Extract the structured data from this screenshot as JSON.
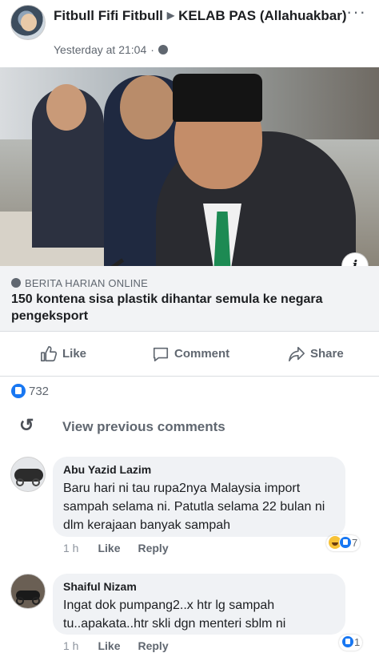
{
  "post": {
    "author": "Fitbull Fifi Fitbull",
    "arrow": "▶",
    "group": "KELAB PAS",
    "subtitle": "(Allahuakbar)",
    "time": "Yesterday at 21:04",
    "separator": "·",
    "more": "···",
    "icons": {
      "more": "more-dots-icon",
      "audience": "globe-icon",
      "info": "info-icon"
    }
  },
  "link": {
    "source": "BERITA HARIAN ONLINE",
    "title": "150 kontena sisa plastik dihantar semula ke negara pengeksport",
    "info_glyph": "i"
  },
  "actions": {
    "like": "Like",
    "comment": "Comment",
    "share": "Share",
    "icons": {
      "like": "thumbs-up-icon",
      "comment": "comment-bubble-icon",
      "share": "share-arrow-icon"
    }
  },
  "reactions": {
    "count": "732",
    "icon": "like-reaction-icon"
  },
  "view_previous": {
    "label": "View previous comments",
    "icon": "rotate-arrow-icon"
  },
  "comments": [
    {
      "name": "Abu Yazid Lazim",
      "text": "Baru hari ni tau rupa2nya Malaysia import sampah selama ni. Patutla selama 22 bulan ni dlm kerajaan banyak sampah",
      "time": "1 h",
      "like": "Like",
      "reply": "Reply",
      "reaction_count": "7",
      "reaction_icons": [
        "haha-icon",
        "like-icon"
      ]
    },
    {
      "name": "Shaiful Nizam",
      "text": "Ingat dok pumpang2..x htr lg sampah tu..apakata..htr skli dgn menteri sblm ni",
      "time": "1 h",
      "like": "Like",
      "reply": "Reply",
      "reaction_count": "1",
      "reaction_icons": [
        "like-icon"
      ]
    }
  ],
  "colors": {
    "accent": "#1877f2",
    "secondary_text": "#606770",
    "bubble": "#f0f2f5",
    "link_card": "#f2f3f5"
  }
}
